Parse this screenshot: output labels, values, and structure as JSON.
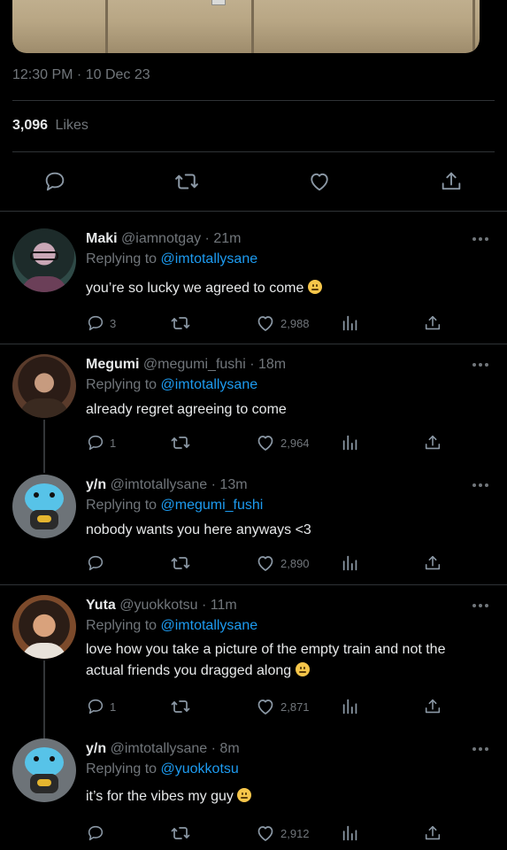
{
  "tweet": {
    "timestamp": "12:30 PM · 10 Dec 23",
    "likes_count": "3,096",
    "likes_label": "Likes"
  },
  "replies": [
    {
      "name": "Maki",
      "meta": "@iamnotgay · 21m",
      "replying_prefix": "Replying to",
      "replying_handle": "@imtotallysane",
      "text": "you’re so lucky we agreed to come",
      "emoji": "😐",
      "replies": "3",
      "likes": "2,988"
    },
    {
      "name": "Megumi",
      "meta": "@megumi_fushi · 18m",
      "replying_prefix": "Replying to",
      "replying_handle": "@imtotallysane",
      "text": "already regret agreeing to come",
      "replies": "1",
      "likes": "2,964"
    },
    {
      "name": "y/n",
      "meta": "@imtotallysane · 13m",
      "replying_prefix": "Replying to",
      "replying_handle": "@megumi_fushi",
      "text": "nobody wants you here anyways <3",
      "replies": "",
      "likes": "2,890"
    },
    {
      "name": "Yuta",
      "meta": "@yuokkotsu · 11m",
      "replying_prefix": "Replying to",
      "replying_handle": "@imtotallysane",
      "text": "love how you take a picture of the empty train and not the actual friends you dragged along",
      "emoji": "😑",
      "replies": "1",
      "likes": "2,871"
    },
    {
      "name": "y/n",
      "meta": "@imtotallysane · 8m",
      "replying_prefix": "Replying to",
      "replying_handle": "@yuokkotsu",
      "text": "it’s for the vibes my guy",
      "emoji": "😒",
      "replies": "",
      "likes": "2,912"
    }
  ],
  "icons": {
    "reply": "speech-bubble-icon",
    "retweet": "retweet-icon",
    "like": "heart-icon",
    "views": "bar-chart-icon",
    "share": "share-icon",
    "more": "ellipsis-icon"
  },
  "colors": {
    "background": "#000000",
    "text": "#e7e9ea",
    "muted": "#71767b",
    "link": "#1d9bf0",
    "divider": "#2f3336"
  }
}
